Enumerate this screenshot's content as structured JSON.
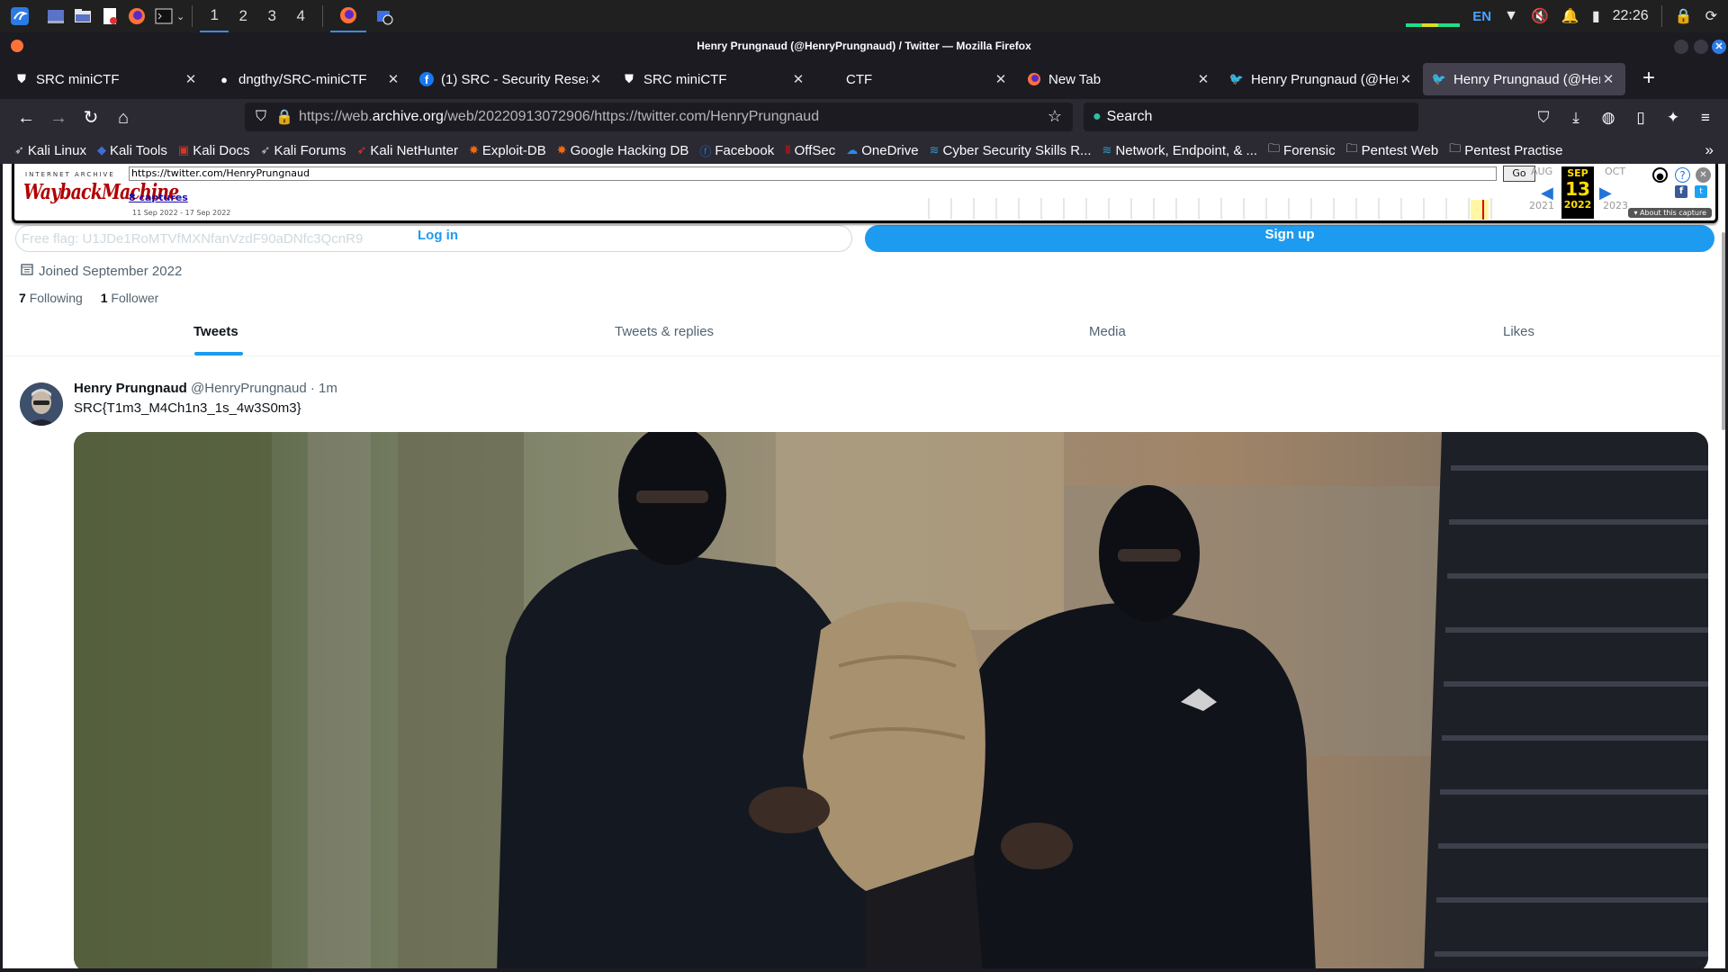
{
  "panel": {
    "workspaces": [
      "1",
      "2",
      "3",
      "4"
    ],
    "active_workspace": "1",
    "language": "EN",
    "time": "22:26",
    "badge": "2"
  },
  "window": {
    "title": "Henry Prungnaud (@HenryPrungnaud) / Twitter — Mozilla Firefox"
  },
  "tabs": [
    {
      "label": "SRC miniCTF",
      "icon": "shield-icon"
    },
    {
      "label": "dngthy/SRC-miniCTF",
      "icon": "github-icon"
    },
    {
      "label": "(1) SRC - Security Researc",
      "icon": "facebook-icon"
    },
    {
      "label": "SRC miniCTF",
      "icon": "shield-icon"
    },
    {
      "label": "CTF",
      "icon": ""
    },
    {
      "label": "New Tab",
      "icon": "firefox-icon"
    },
    {
      "label": "Henry Prungnaud (@Henr",
      "icon": "twitter-icon"
    },
    {
      "label": "Henry Prungnaud (@Henr",
      "icon": "twitter-icon",
      "selected": true
    }
  ],
  "navbar": {
    "url_prefix": "https://web.",
    "url_domain": "archive.org",
    "url_rest": "/web/20220913072906/https://twitter.com/HenryPrungnaud",
    "search_placeholder": "Search"
  },
  "bookmarks": [
    {
      "label": "Kali Linux",
      "icon": "kali-icon"
    },
    {
      "label": "Kali Tools",
      "icon": "kali-tools-icon"
    },
    {
      "label": "Kali Docs",
      "icon": "kali-docs-icon"
    },
    {
      "label": "Kali Forums",
      "icon": "kali-icon"
    },
    {
      "label": "Kali NetHunter",
      "icon": "nethunter-icon"
    },
    {
      "label": "Exploit-DB",
      "icon": "exploitdb-icon"
    },
    {
      "label": "Google Hacking DB",
      "icon": "exploitdb-icon"
    },
    {
      "label": "Facebook",
      "icon": "facebook-icon"
    },
    {
      "label": "OffSec",
      "icon": "offsec-icon"
    },
    {
      "label": "OneDrive",
      "icon": "onedrive-icon"
    },
    {
      "label": "Cyber Security Skills R...",
      "icon": "sans-icon"
    },
    {
      "label": "Network, Endpoint, & ...",
      "icon": "sans-icon"
    },
    {
      "label": "Forensic",
      "icon": "folder-icon"
    },
    {
      "label": "Pentest Web",
      "icon": "folder-icon"
    },
    {
      "label": "Pentest Practise",
      "icon": "folder-icon"
    }
  ],
  "wayback": {
    "logo_top": "INTERNET ARCHIVE",
    "logo": "WaybackMachine",
    "url": "https://twitter.com/HenryPrungnaud",
    "go": "Go",
    "captures": "8 captures",
    "range": "11 Sep 2022 - 17 Sep 2022",
    "prev_month": "AUG",
    "cur_month": "SEP",
    "next_month": "OCT",
    "day": "13",
    "prev_year": "2021",
    "cur_year": "2022",
    "next_year": "2023",
    "about": "About this capture"
  },
  "profile": {
    "free_flag": "Free flag: U1JDe1RoMTVfMXNfanVzdF90aDNfc3QcnR9",
    "login": "Log in",
    "signup": "Sign up",
    "joined": "Joined September 2022",
    "following_count": "7",
    "following_label": "Following",
    "followers_count": "1",
    "followers_label": "Follower",
    "tabs": [
      "Tweets",
      "Tweets & replies",
      "Media",
      "Likes"
    ]
  },
  "tweet": {
    "name": "Henry Prungnaud",
    "handle": "@HenryPrungnaud",
    "time": "· 1m",
    "text": "SRC{T1m3_M4Ch1n3_1s_4w3S0m3}"
  },
  "colors": {
    "accent": "#1d9bf0",
    "wayback_red": "#b10000",
    "firefox_bg": "#1c1b22"
  }
}
